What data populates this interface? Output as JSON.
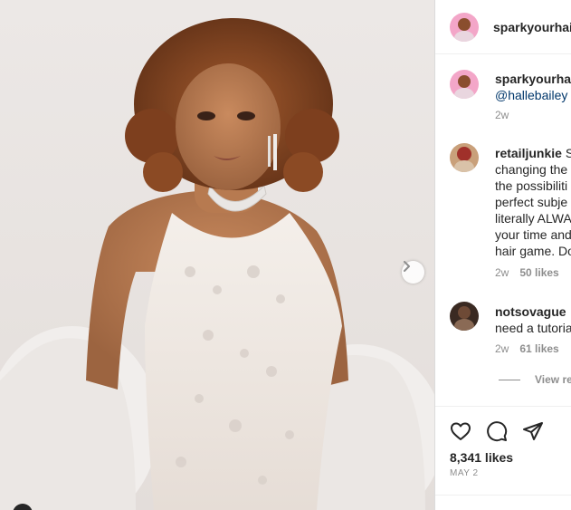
{
  "post": {
    "author": "sparkyourhai",
    "likes": "8,341 likes",
    "date": "MAY 2"
  },
  "caption": {
    "username": "sparkyourha",
    "mention": "@hallebailey",
    "time": "2w"
  },
  "comments": [
    {
      "username": "retailjunkie",
      "text_first": "S",
      "lines": [
        "changing the",
        "the possibiliti",
        "perfect subje",
        "literally ALWA",
        "your time and",
        "hair game. Do"
      ],
      "time": "2w",
      "likes": "50 likes"
    },
    {
      "username": "notsovague",
      "text_first": "",
      "lines": [
        "need a tutoria"
      ],
      "time": "2w",
      "likes": "61 likes"
    }
  ],
  "view_replies": "View re",
  "icons": {
    "next": "chevron-right-icon",
    "like": "heart-icon",
    "comment": "comment-bubble-icon",
    "share": "paper-plane-icon"
  },
  "colors": {
    "text": "#262626",
    "muted": "#8e8e8e",
    "link": "#00376b",
    "border": "#dbdbdb"
  }
}
